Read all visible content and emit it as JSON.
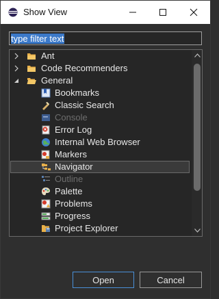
{
  "window": {
    "title": "Show View"
  },
  "titlebar_icons": [
    "eclipse-icon",
    "minimize-icon",
    "maximize-icon",
    "close-icon"
  ],
  "filter": {
    "value": "type filter text"
  },
  "tree": {
    "items": [
      {
        "label": "Ant",
        "icon": "folder-icon",
        "level": 0,
        "expanded": false,
        "enabled": true
      },
      {
        "label": "Code Recommenders",
        "icon": "folder-icon",
        "level": 0,
        "expanded": false,
        "enabled": true
      },
      {
        "label": "General",
        "icon": "folder-icon",
        "level": 0,
        "expanded": true,
        "enabled": true
      },
      {
        "label": "Bookmarks",
        "icon": "bookmarks-icon",
        "level": 1,
        "enabled": true
      },
      {
        "label": "Classic Search",
        "icon": "search-flashlight-icon",
        "level": 1,
        "enabled": true
      },
      {
        "label": "Console",
        "icon": "console-icon",
        "level": 1,
        "enabled": false
      },
      {
        "label": "Error Log",
        "icon": "error-log-icon",
        "level": 1,
        "enabled": true
      },
      {
        "label": "Internal Web Browser",
        "icon": "globe-icon",
        "level": 1,
        "enabled": true
      },
      {
        "label": "Markers",
        "icon": "markers-icon",
        "level": 1,
        "enabled": true
      },
      {
        "label": "Navigator",
        "icon": "navigator-icon",
        "level": 1,
        "enabled": true,
        "selected": true
      },
      {
        "label": "Outline",
        "icon": "outline-icon",
        "level": 1,
        "enabled": false
      },
      {
        "label": "Palette",
        "icon": "palette-icon",
        "level": 1,
        "enabled": true
      },
      {
        "label": "Problems",
        "icon": "problems-icon",
        "level": 1,
        "enabled": true
      },
      {
        "label": "Progress",
        "icon": "progress-icon",
        "level": 1,
        "enabled": true
      },
      {
        "label": "Project Explorer",
        "icon": "project-explorer-icon",
        "level": 1,
        "enabled": true
      }
    ]
  },
  "buttons": {
    "open": "Open",
    "cancel": "Cancel"
  },
  "colors": {
    "accent": "#4a90d9",
    "selection": "#3b79c9",
    "background": "#2f2f2f"
  }
}
